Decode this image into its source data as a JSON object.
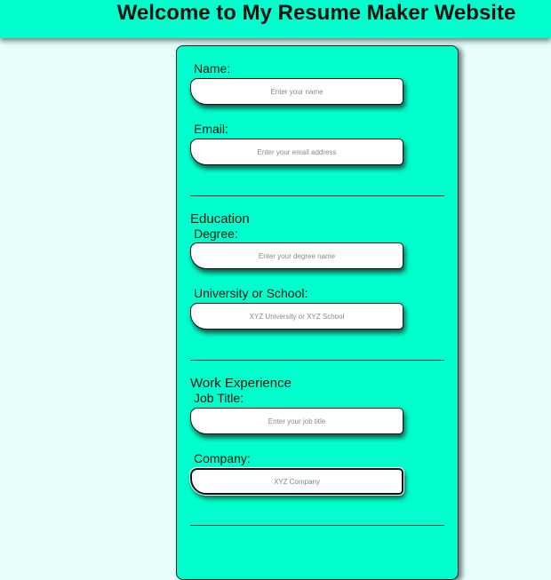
{
  "header": {
    "title": "Welcome to My Resume Maker Website"
  },
  "form": {
    "name": {
      "label": "Name:",
      "placeholder": "Enter your name"
    },
    "email": {
      "label": "Email:",
      "placeholder": "Enter your email address"
    },
    "education": {
      "heading": "Education",
      "degree": {
        "label": "Degree:",
        "placeholder": "Enter your degree name"
      },
      "school": {
        "label": "University or School:",
        "placeholder": "XYZ University or XYZ School"
      }
    },
    "work": {
      "heading": "Work Experience",
      "job_title": {
        "label": "Job Title:",
        "placeholder": "Enter your job title"
      },
      "company": {
        "label": "Company:",
        "placeholder": "XYZ Company"
      }
    }
  }
}
